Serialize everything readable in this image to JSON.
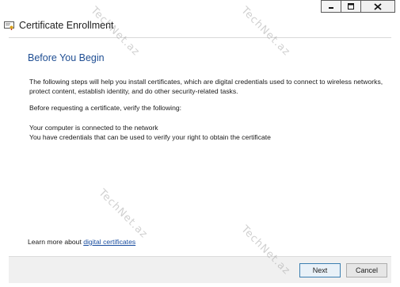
{
  "window": {
    "title": "Certificate Enrollment",
    "controls": {
      "minimize": "minimize-icon",
      "maximize": "maximize-icon",
      "close": "close-icon"
    }
  },
  "page": {
    "heading": "Before You Begin",
    "intro": "The following steps will help you install certificates, which are digital credentials used to connect to wireless networks, protect content, establish identity, and do other security-related tasks.",
    "verify_prompt": "Before requesting a certificate, verify the following:",
    "checklist": [
      "Your computer is connected to the network",
      "You have credentials that can be used to verify your right to obtain the certificate"
    ],
    "learn_more_prefix": "Learn more about ",
    "learn_more_link": "digital certificates"
  },
  "buttons": {
    "next": "Next",
    "cancel": "Cancel"
  },
  "watermark": "TechNet.az",
  "colors": {
    "heading": "#1f4e93",
    "link": "#1a4ea0",
    "footer": "#f0f0f0"
  }
}
